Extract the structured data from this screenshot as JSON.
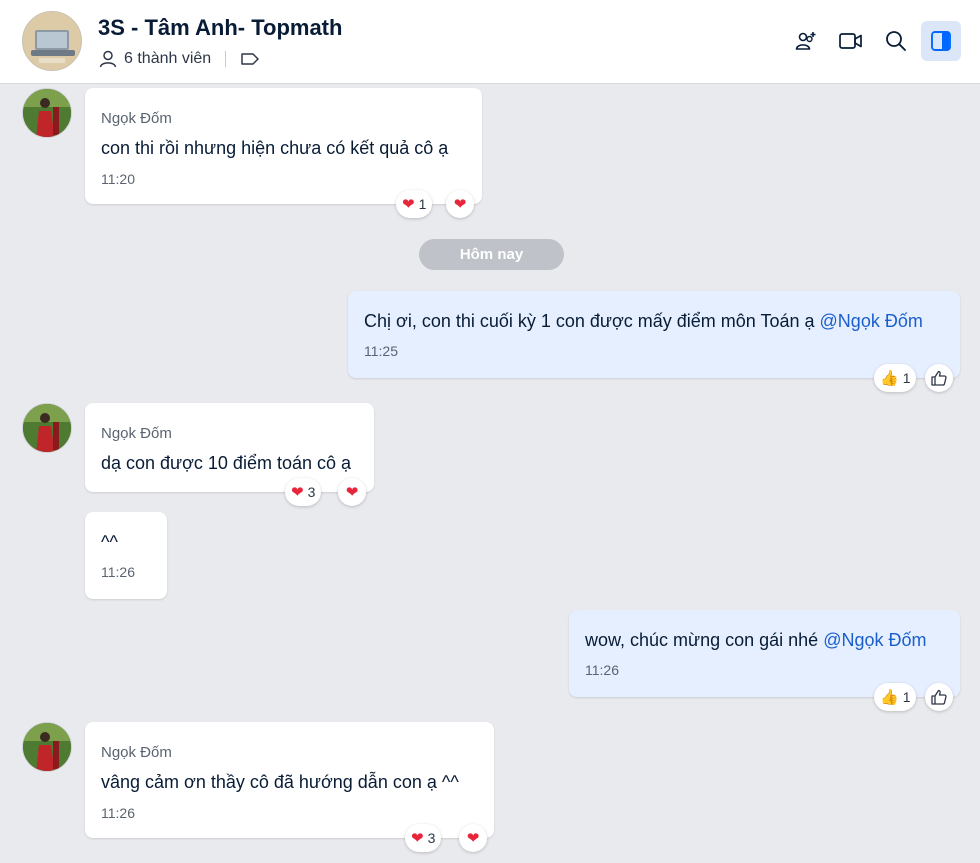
{
  "header": {
    "title": "3S - Tâm Anh- Topmath",
    "members": "6 thành viên"
  },
  "date_separator": "Hôm nay",
  "messages": [
    {
      "sender": "Ngọk Đốm",
      "text": "con thi rồi nhưng hiện chưa có kết quả cô ạ",
      "time": "11:20",
      "reaction_count": "1"
    },
    {
      "text": "Chị ơi, con thi cuối kỳ 1 con được mấy điểm môn Toán ạ ",
      "mention": "@Ngọk Đốm",
      "time": "11:25",
      "reaction_count": "1"
    },
    {
      "sender": "Ngọk Đốm",
      "text": "dạ con được 10 điểm toán cô ạ",
      "reaction_count": "3"
    },
    {
      "text": "^^",
      "time": "11:26"
    },
    {
      "text": "wow, chúc mừng con gái nhé ",
      "mention": "@Ngọk Đốm",
      "time": "11:26",
      "reaction_count": "1"
    },
    {
      "sender": "Ngọk Đốm",
      "text": "vâng cảm ơn thầy cô đã hướng dẫn con ạ ^^",
      "time": "11:26",
      "reaction_count": "3"
    }
  ],
  "colors": {
    "accent": "#0068ff",
    "mine_bubble": "#e5efff",
    "mention": "#1a5fcc"
  }
}
